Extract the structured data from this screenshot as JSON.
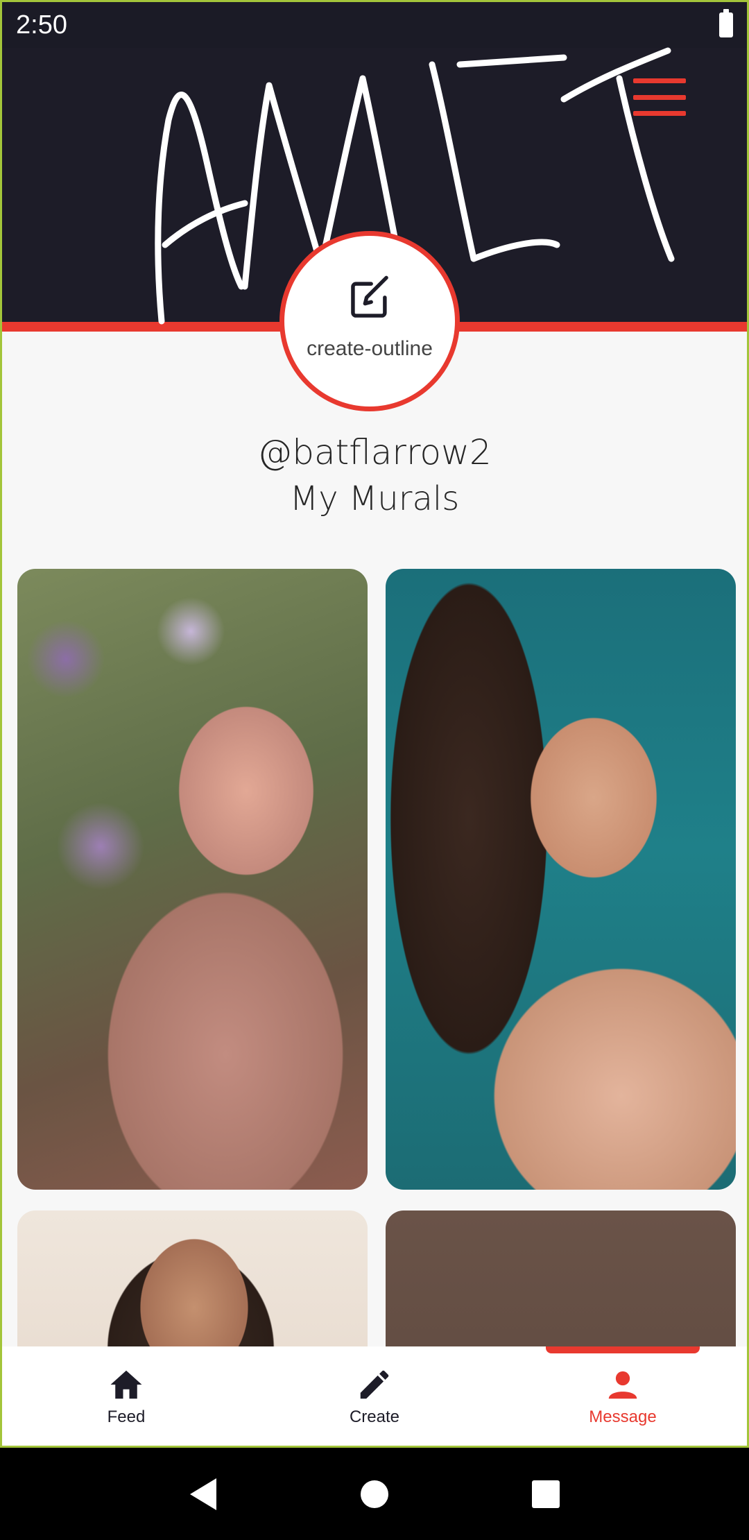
{
  "status_bar": {
    "time": "2:50",
    "battery_icon": "battery-full-icon"
  },
  "header": {
    "signature_text": "AMIT",
    "menu_icon": "hamburger-menu-icon",
    "accent_color": "#e8392f",
    "bg_color": "#1d1c28"
  },
  "avatar": {
    "icon": "create-outline-icon",
    "label": "create-outline"
  },
  "profile": {
    "username": "@batflarrow2",
    "section_title": "My Murals"
  },
  "murals": [
    {
      "id": "mural-1"
    },
    {
      "id": "mural-2"
    },
    {
      "id": "mural-3"
    },
    {
      "id": "mural-4"
    }
  ],
  "bottom_nav": {
    "items": [
      {
        "label": "Feed",
        "icon": "home-icon",
        "active": false
      },
      {
        "label": "Create",
        "icon": "pencil-icon",
        "active": false
      },
      {
        "label": "Message",
        "icon": "person-icon",
        "active": true
      }
    ]
  },
  "system_nav": {
    "back_icon": "back-icon",
    "home_icon": "home-circle-icon",
    "recents_icon": "recents-icon"
  }
}
